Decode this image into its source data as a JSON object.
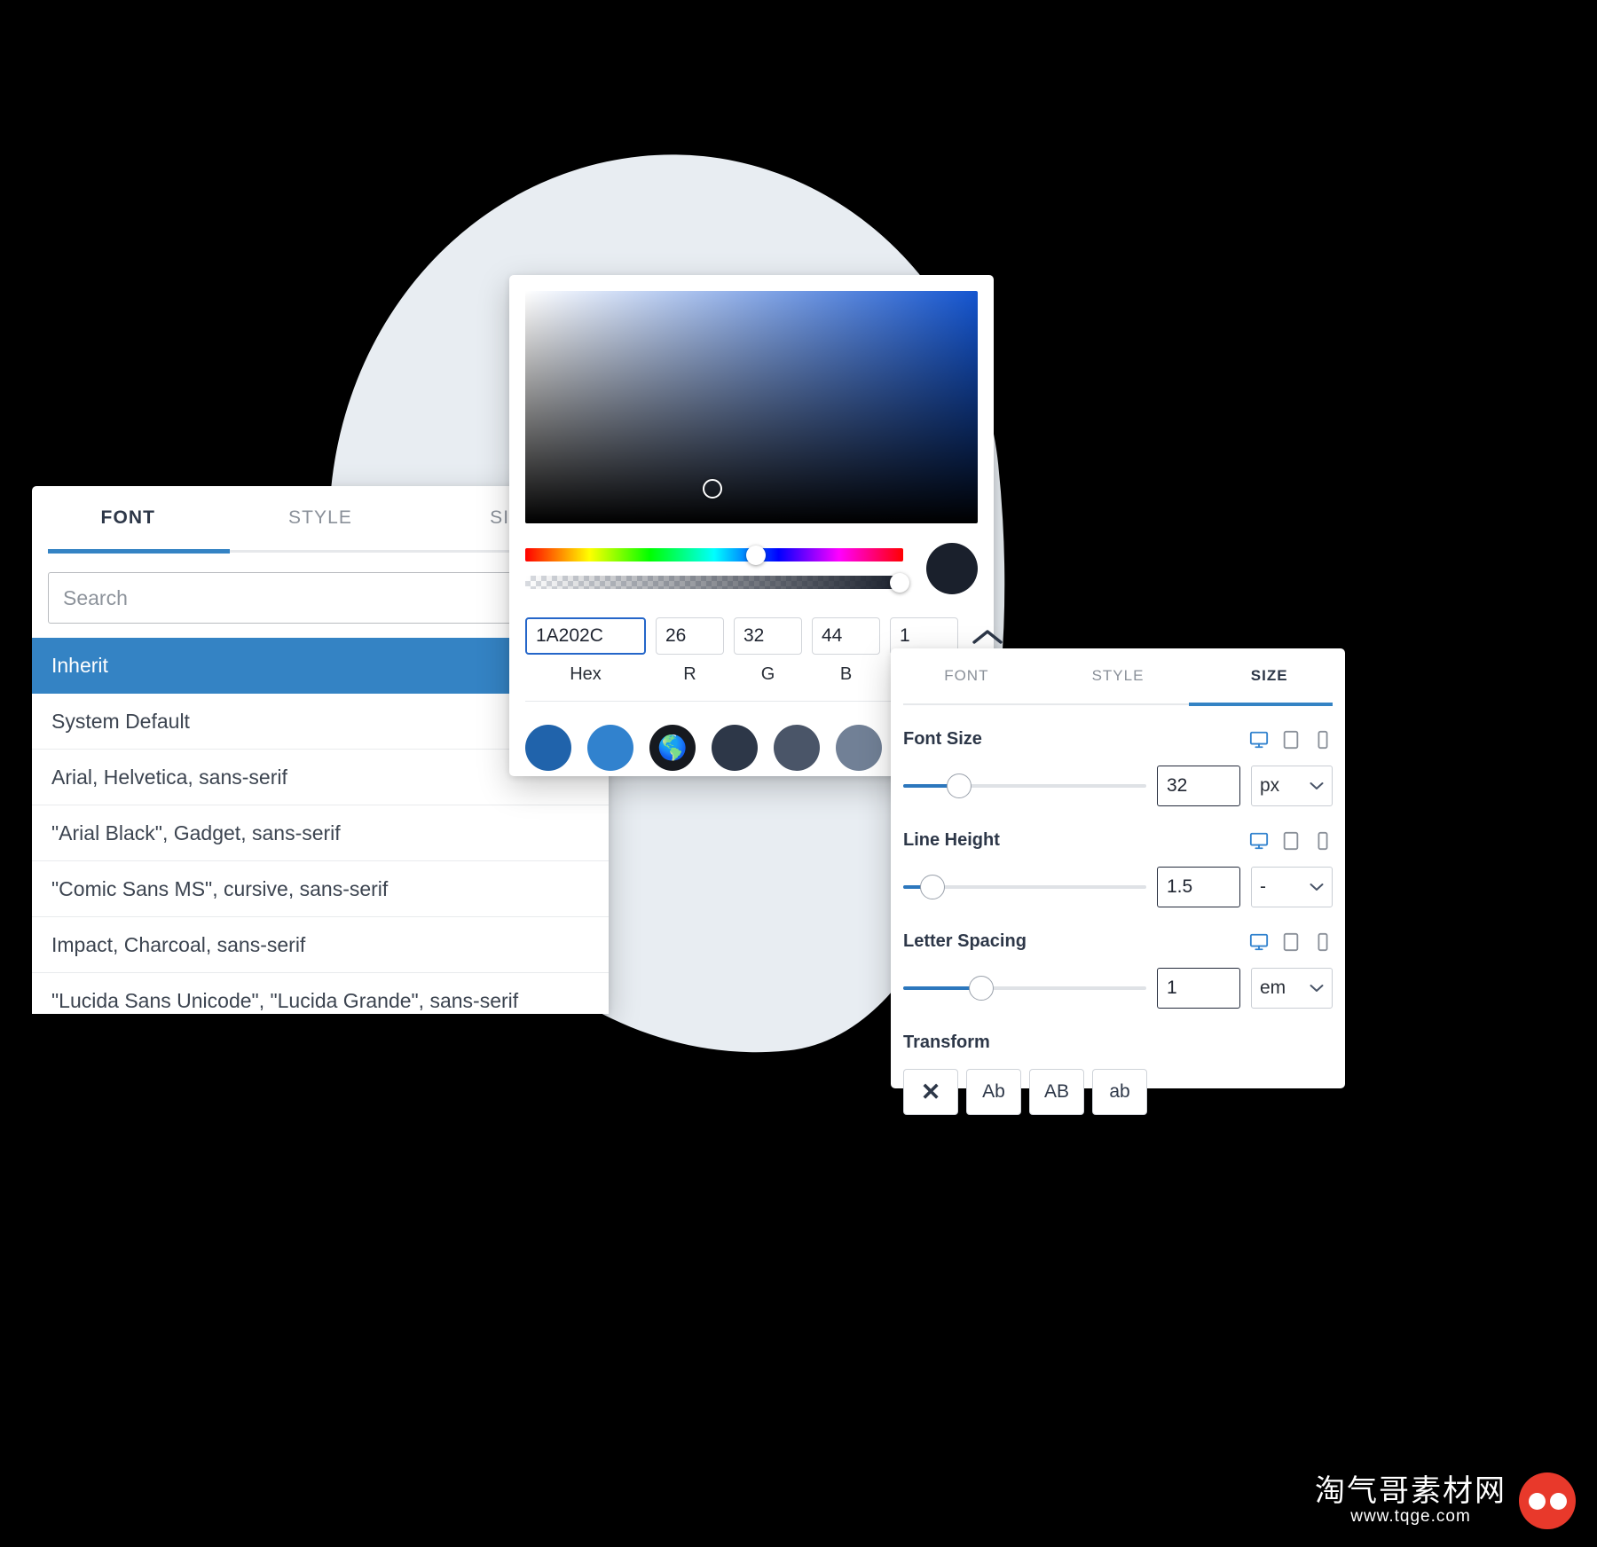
{
  "font_panel": {
    "tabs": [
      {
        "label": "FONT",
        "active": true
      },
      {
        "label": "STYLE",
        "active": false
      },
      {
        "label": "SIZE",
        "active": false
      }
    ],
    "search": {
      "placeholder": "Search",
      "value": ""
    },
    "items": [
      {
        "label": "Inherit",
        "selected": true
      },
      {
        "label": "System Default",
        "selected": false
      },
      {
        "label": "Arial, Helvetica, sans-serif",
        "selected": false
      },
      {
        "label": "\"Arial Black\", Gadget, sans-serif",
        "selected": false
      },
      {
        "label": "\"Comic Sans MS\", cursive, sans-serif",
        "selected": false
      },
      {
        "label": "Impact, Charcoal, sans-serif",
        "selected": false
      },
      {
        "label": "\"Lucida Sans Unicode\", \"Lucida Grande\", sans-serif",
        "selected": false
      }
    ]
  },
  "color_panel": {
    "selected_color": "#1A202C",
    "fields": [
      {
        "name": "hex",
        "value": "1A202C",
        "label": "Hex"
      },
      {
        "name": "r",
        "value": "26",
        "label": "R"
      },
      {
        "name": "g",
        "value": "32",
        "label": "G"
      },
      {
        "name": "b",
        "value": "44",
        "label": "B"
      },
      {
        "name": "alpha",
        "value": "1",
        "label": ""
      }
    ],
    "collapse_icon": "chevron-up-icon",
    "hue_position_pct": 61,
    "alpha_position_pct": 99,
    "swatches": [
      {
        "color": "#2063ab",
        "icon": ""
      },
      {
        "color": "#3182ce",
        "icon": ""
      },
      {
        "color": "#16191f",
        "icon": "globe-icon"
      },
      {
        "color": "#2d3748",
        "icon": ""
      },
      {
        "color": "#4a5568",
        "icon": ""
      },
      {
        "color": "#718096",
        "icon": ""
      },
      {
        "color": "#edf2f7",
        "icon": ""
      },
      {
        "color": "#f7fafc",
        "icon": ""
      }
    ]
  },
  "size_panel": {
    "tabs": [
      {
        "label": "FONT",
        "active": false
      },
      {
        "label": "STYLE",
        "active": false
      },
      {
        "label": "SIZE",
        "active": true
      }
    ],
    "controls": [
      {
        "label": "Font Size",
        "value": "32",
        "unit": "px",
        "slider_pct": 23,
        "devices": [
          "desktop-icon",
          "tablet-icon",
          "mobile-icon"
        ]
      },
      {
        "label": "Line Height",
        "value": "1.5",
        "unit": "-",
        "slider_pct": 12,
        "devices": [
          "desktop-icon",
          "tablet-icon",
          "mobile-icon"
        ]
      },
      {
        "label": "Letter Spacing",
        "value": "1",
        "unit": "em",
        "slider_pct": 32,
        "devices": [
          "desktop-icon",
          "tablet-icon",
          "mobile-icon"
        ]
      }
    ],
    "transform": {
      "label": "Transform",
      "buttons": [
        {
          "label": "✕",
          "name": "transform-none"
        },
        {
          "label": "Ab",
          "name": "transform-capitalize"
        },
        {
          "label": "AB",
          "name": "transform-uppercase"
        },
        {
          "label": "ab",
          "name": "transform-lowercase"
        }
      ]
    }
  },
  "watermark": {
    "cn": "淘气哥素材网",
    "url": "www.tqge.com"
  },
  "colors": {
    "accent": "#3483c4",
    "selected_row": "#3483c4",
    "slider_fill": "#2c77bd",
    "focus_border": "#2566c9",
    "blob": "#e8edf2",
    "background": "#000000"
  }
}
